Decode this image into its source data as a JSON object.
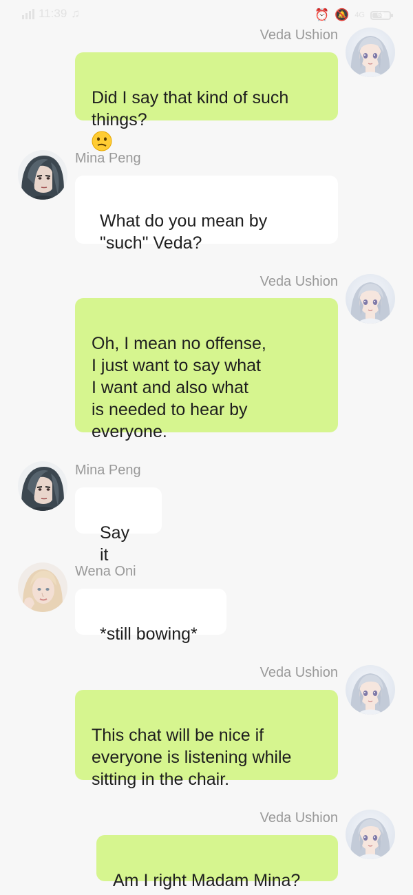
{
  "status_bar": {
    "carrier": "4G",
    "time": "11:39",
    "network": "4G",
    "battery": "65"
  },
  "messages": [
    {
      "sender": "Veda Ushion",
      "text": "Did I say that kind of such\nthings?",
      "emoji": "confused-face-icon",
      "side": "right"
    },
    {
      "sender": "Mina Peng",
      "text": "What do you mean by\n\"such\" Veda?",
      "side": "left"
    },
    {
      "sender": "Veda Ushion",
      "text": "Oh, I mean no offense,\nI just want to say what\nI want and also what\nis needed to hear by\neveryone.",
      "side": "right"
    },
    {
      "sender": "Mina Peng",
      "text": "Say it",
      "side": "left"
    },
    {
      "sender": "Wena Oni",
      "text": "*still bowing*",
      "side": "left"
    },
    {
      "sender": "Veda Ushion",
      "text": "This chat will be nice if\neveryone is listening while\nsitting in the chair.",
      "side": "right"
    },
    {
      "sender": "Veda Ushion",
      "text": "Am I right Madam Mina?",
      "side": "right"
    }
  ],
  "colors": {
    "background": "#f7f7f7",
    "bubble_self": "#d6f58f",
    "bubble_other": "#ffffff",
    "sender_name": "#999999",
    "text": "#1e1e1e"
  },
  "icons": {
    "veda_avatar": "anime-girl-silver-hair-avatar",
    "mina_avatar": "dark-hair-woman-avatar",
    "wena_avatar": "blonde-woman-avatar"
  }
}
